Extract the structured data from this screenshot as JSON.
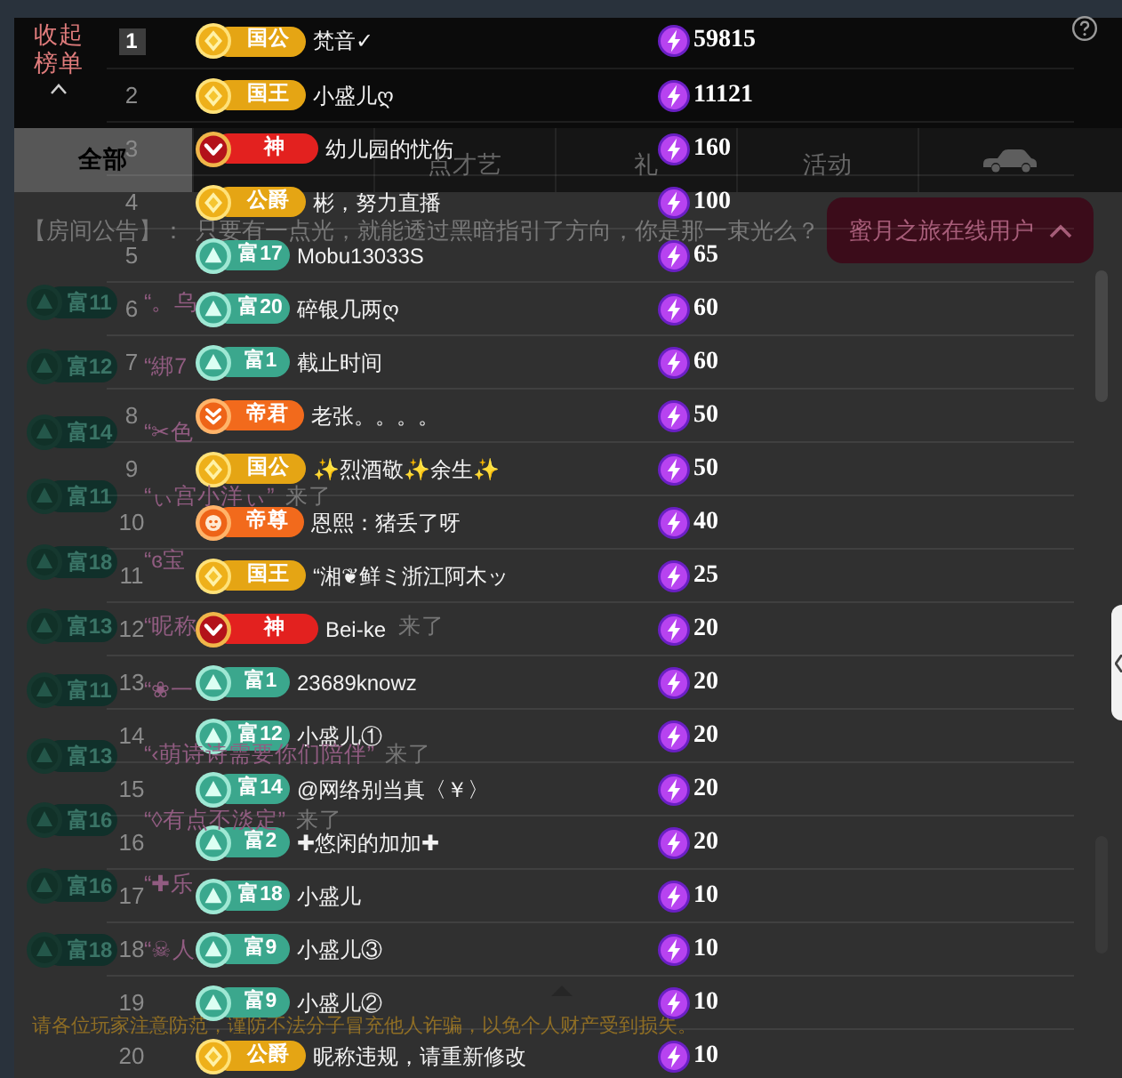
{
  "leaderboard": {
    "collapse_label": "收起榜单",
    "rows": [
      {
        "rank": "1",
        "boxed": true,
        "badge": {
          "kind": "diamond",
          "label": "国公",
          "color": "#e5a514"
        },
        "name": "梵音✓",
        "value": "59815"
      },
      {
        "rank": "2",
        "boxed": false,
        "badge": {
          "kind": "diamond",
          "label": "国王",
          "color": "#e5a514"
        },
        "name": "小盛儿ღ",
        "value": "11121"
      },
      {
        "rank": "3",
        "boxed": false,
        "badge": {
          "kind": "chevron",
          "label": "神",
          "color": "#e3211f"
        },
        "name": "幼儿园的忧伤",
        "value": "160"
      },
      {
        "rank": "4",
        "boxed": false,
        "badge": {
          "kind": "diamond",
          "label": "公爵",
          "color": "#e5a514"
        },
        "name": "彬，努力直播",
        "value": "100"
      },
      {
        "rank": "5",
        "boxed": false,
        "badge": {
          "kind": "triangle",
          "label": "富17",
          "color": "#3ba78d"
        },
        "name": "Mobu13033S",
        "value": "65"
      },
      {
        "rank": "6",
        "boxed": false,
        "badge": {
          "kind": "triangle",
          "label": "富20",
          "color": "#3ba78d"
        },
        "name": "碎银几两ღ",
        "value": "60"
      },
      {
        "rank": "7",
        "boxed": false,
        "badge": {
          "kind": "triangle",
          "label": "富1",
          "color": "#3ba78d"
        },
        "name": "截止时间",
        "value": "60"
      },
      {
        "rank": "8",
        "boxed": false,
        "badge": {
          "kind": "chevrons",
          "label": "帝君",
          "color": "#f26a1c"
        },
        "name": "老张。。。。",
        "value": "50"
      },
      {
        "rank": "9",
        "boxed": false,
        "badge": {
          "kind": "diamond",
          "label": "国公",
          "color": "#e5a514"
        },
        "name": "✨烈酒敬✨余生✨",
        "value": "50"
      },
      {
        "rank": "10",
        "boxed": false,
        "badge": {
          "kind": "crest",
          "label": "帝尊",
          "color": "#f26a1c"
        },
        "name": "恩熙：猪丢了呀",
        "value": "40"
      },
      {
        "rank": "11",
        "boxed": false,
        "badge": {
          "kind": "diamond",
          "label": "国王",
          "color": "#e5a514"
        },
        "name": "“湘❦鲜ミ浙江阿木ッ",
        "value": "25"
      },
      {
        "rank": "12",
        "boxed": false,
        "badge": {
          "kind": "chevron",
          "label": "神",
          "color": "#e3211f"
        },
        "name": "Bei-ke",
        "value": "20"
      },
      {
        "rank": "13",
        "boxed": false,
        "badge": {
          "kind": "triangle",
          "label": "富1",
          "color": "#3ba78d"
        },
        "name": "23689knowz",
        "value": "20"
      },
      {
        "rank": "14",
        "boxed": false,
        "badge": {
          "kind": "triangle",
          "label": "富12",
          "color": "#3ba78d"
        },
        "name": "小盛儿①",
        "value": "20"
      },
      {
        "rank": "15",
        "boxed": false,
        "badge": {
          "kind": "triangle",
          "label": "富14",
          "color": "#3ba78d"
        },
        "name": "@网络别当真〈￥〉",
        "value": "20"
      },
      {
        "rank": "16",
        "boxed": false,
        "badge": {
          "kind": "triangle",
          "label": "富2",
          "color": "#3ba78d"
        },
        "name": "✚悠闲的加加✚",
        "value": "20"
      },
      {
        "rank": "17",
        "boxed": false,
        "badge": {
          "kind": "triangle",
          "label": "富18",
          "color": "#3ba78d"
        },
        "name": "小盛儿",
        "value": "10"
      },
      {
        "rank": "18",
        "boxed": false,
        "badge": {
          "kind": "triangle",
          "label": "富9",
          "color": "#3ba78d"
        },
        "name": "小盛儿③",
        "value": "10"
      },
      {
        "rank": "19",
        "boxed": false,
        "badge": {
          "kind": "triangle",
          "label": "富9",
          "color": "#3ba78d"
        },
        "name": "小盛儿②",
        "value": "10"
      },
      {
        "rank": "20",
        "boxed": false,
        "badge": {
          "kind": "diamond",
          "label": "公爵",
          "color": "#e5a514"
        },
        "name": "昵称违规，请重新修改",
        "value": "10"
      }
    ]
  },
  "page": {
    "tabs": [
      {
        "kind": "text",
        "label": "全部",
        "selected": true
      },
      {
        "kind": "covered"
      },
      {
        "kind": "text",
        "label": "点才艺",
        "selected": false
      },
      {
        "kind": "text",
        "label": "礼",
        "selected": false
      },
      {
        "kind": "text",
        "label": "活动",
        "selected": false
      },
      {
        "kind": "icon",
        "selected": false
      }
    ],
    "announcement": {
      "label": "【房间公告】：",
      "text": "只要有一点光，就能透过黑暗指引了方向，你是那一束光么？"
    },
    "online_users_button": "蜜月之旅在线用户",
    "chat": [
      {
        "kind": "cut",
        "badge": "富11",
        "name": "“。乌"
      },
      {
        "kind": "cut",
        "badge": "富12",
        "name": "“綁7"
      },
      {
        "kind": "cut",
        "badge": "富14",
        "name": "“✂色"
      },
      {
        "kind": "whole",
        "badge": "富11",
        "name": "“ぃ宫小洋ぃ”",
        "action": "来了"
      },
      {
        "kind": "cut",
        "badge": "富18",
        "name": "“ɞ宝"
      },
      {
        "kind": "cut",
        "badge": "富13",
        "name": "“昵称",
        "action": "来了"
      },
      {
        "kind": "cut",
        "badge": "富11",
        "name": "“❀一"
      },
      {
        "kind": "whole",
        "badge": "富13",
        "name": "“‹萌诗诗需要你们陪伴”",
        "action": "来了"
      },
      {
        "kind": "whole",
        "badge": "富16",
        "name": "“◊有点不淡定”",
        "action": "来了"
      },
      {
        "kind": "cut",
        "badge": "富16",
        "name": "“✚乐"
      },
      {
        "kind": "cut",
        "badge": "富18",
        "name": "“☠人"
      }
    ],
    "notice": "请各位玩家注意防范，谨防不法分子冒充他人诈骗，以免个人财产受到损失。"
  }
}
